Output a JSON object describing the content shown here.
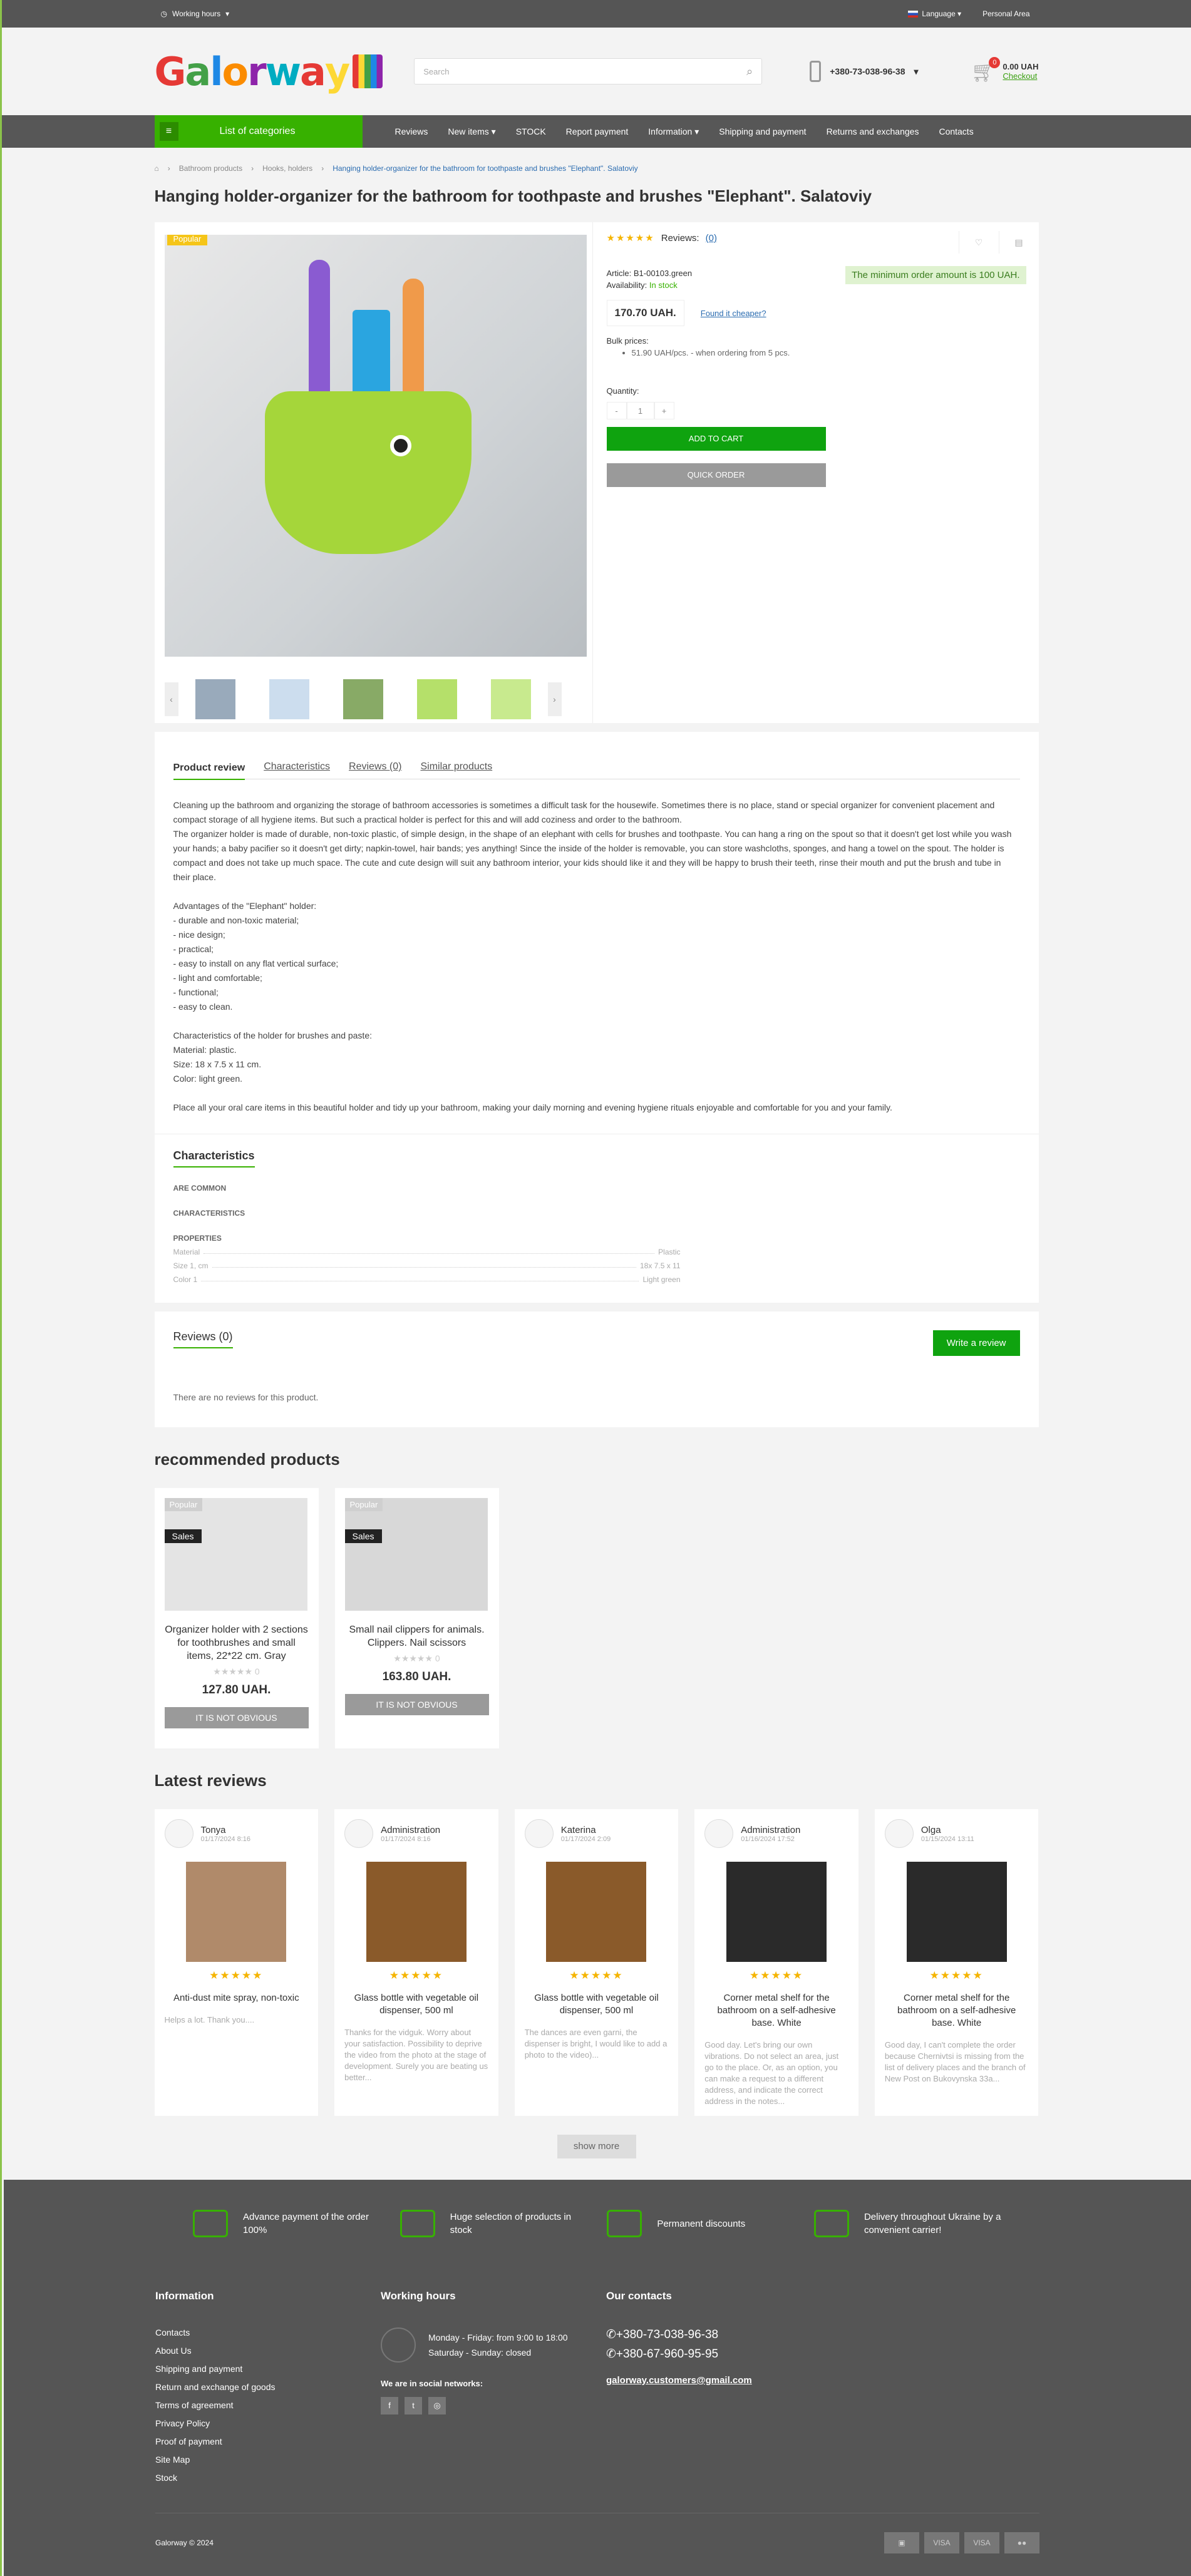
{
  "topbar": {
    "working_hours": "Working hours",
    "language": "Language",
    "personal_area": "Personal Area"
  },
  "header": {
    "logo": [
      "G",
      "a",
      "l",
      "o",
      "r",
      "w",
      "a",
      "y"
    ],
    "search_placeholder": "Search",
    "phone": "+380-73-038-96-38",
    "cart_count": "0",
    "cart_total": "0.00 UAH",
    "checkout": "Checkout"
  },
  "nav": {
    "categories": "List of categories",
    "items": [
      "Reviews",
      "New items",
      "STOCK",
      "Report payment",
      "Information",
      "Shipping and payment",
      "Returns and exchanges",
      "Contacts"
    ]
  },
  "breadcrumb": [
    "Bathroom products",
    "Hooks, holders",
    "Hanging holder-organizer for the bathroom for toothpaste and brushes \"Elephant\". Salatoviy"
  ],
  "product": {
    "title": "Hanging holder-organizer for the bathroom for toothpaste and brushes \"Elephant\". Salatoviy",
    "badge": "Popular",
    "stars": "★★★★★",
    "reviews_label": "Reviews:",
    "reviews_count": "(0)",
    "min_order": "The minimum order amount is 100 UAH.",
    "article_label": "Article:",
    "article": "B1-00103.green",
    "availability_label": "Availability:",
    "availability": "In stock",
    "price": "170.70 UAH.",
    "cheaper": "Found it cheaper?",
    "bulk_title": "Bulk prices:",
    "bulk_item": "51.90 UAH/pcs. - when ordering from 5 pcs.",
    "quantity_label": "Quantity:",
    "quantity": "1",
    "add_to_cart": "ADD TO CART",
    "quick_order": "QUICK ORDER"
  },
  "tabs": [
    "Product review",
    "Characteristics",
    "Reviews (0)",
    "Similar products"
  ],
  "description": [
    "Cleaning up the bathroom and organizing the storage of bathroom accessories is sometimes a difficult task for the housewife. Sometimes there is no place, stand or special organizer for convenient placement and compact storage of all hygiene items. But such a practical holder is perfect for this and will add coziness and order to the bathroom.",
    "The organizer holder is made of durable, non-toxic plastic, of simple design, in the shape of an elephant with cells for brushes and toothpaste. You can hang a ring on the spout so that it doesn't get lost while you wash your hands; a baby pacifier so it doesn't get dirty; napkin-towel, hair bands; yes anything! Since the inside of the holder is removable, you can store washcloths, sponges, and hang a towel on the spout. The holder is compact and does not take up much space. The cute and cute design will suit any bathroom interior, your kids should like it and they will be happy to brush their teeth, rinse their mouth and put the brush and tube in their place.",
    "",
    "Advantages of the \"Elephant\" holder:",
    "- durable and non-toxic material;",
    "- nice design;",
    "- practical;",
    "- easy to install on any flat vertical surface;",
    "- light and comfortable;",
    "- functional;",
    "- easy to clean.",
    "",
    "Characteristics of the holder for brushes and paste:",
    "Material: plastic.",
    "Size: 18 x 7.5 x 11 cm.",
    "Color: light green.",
    "",
    "Place all your oral care items in this beautiful holder and tidy up your bathroom, making your daily morning and evening hygiene rituals enjoyable and comfortable for you and your family."
  ],
  "characteristics": {
    "title": "Characteristics",
    "groups": [
      "ARE COMMON",
      "CHARACTERISTICS",
      "PROPERTIES"
    ],
    "rows": [
      {
        "k": "Material",
        "v": "Plastic"
      },
      {
        "k": "Size 1, cm",
        "v": "18x 7.5 x 11"
      },
      {
        "k": "Color 1",
        "v": "Light green"
      }
    ]
  },
  "reviews": {
    "title": "Reviews (0)",
    "write": "Write a review",
    "none": "There are no reviews for this product."
  },
  "recommended": {
    "title": "recommended products",
    "items": [
      {
        "popular": "Popular",
        "sales": "Sales",
        "title": "Organizer holder with 2 sections for toothbrushes and small items, 22*22 cm. Gray",
        "stars": "★★★★★",
        "count": "0",
        "price": "127.80 UAH.",
        "btn": "IT IS NOT OBVIOUS"
      },
      {
        "popular": "Popular",
        "sales": "Sales",
        "title": "Small nail clippers for animals. Clippers. Nail scissors",
        "stars": "★★★★★",
        "count": "0",
        "price": "163.80 UAH.",
        "btn": "IT IS NOT OBVIOUS"
      }
    ]
  },
  "latest": {
    "title": "Latest reviews",
    "more": "show more",
    "items": [
      {
        "name": "Tonya",
        "date": "01/17/2024 8:16",
        "product": "Anti-dust mite spray, non-toxic",
        "text": "Helps a lot. Thank you...."
      },
      {
        "name": "Administration",
        "date": "01/17/2024 8:16",
        "product": "Glass bottle with vegetable oil dispenser, 500 ml",
        "text": "Thanks for the vidguk. Worry about your satisfaction. Possibility to deprive the video from the photo at the stage of development. Surely you are beating us better..."
      },
      {
        "name": "Katerina",
        "date": "01/17/2024 2:09",
        "product": "Glass bottle with vegetable oil dispenser, 500 ml",
        "text": "The dances are even garni, the dispenser is bright, I would like to add a photo to the video)..."
      },
      {
        "name": "Administration",
        "date": "01/16/2024 17:52",
        "product": "Corner metal shelf for the bathroom on a self-adhesive base. White",
        "text": "Good day. Let's bring our own vibrations. Do not select an area, just go to the place. Or, as an option, you can make a request to a different address, and indicate the correct address in the notes..."
      },
      {
        "name": "Olga",
        "date": "01/15/2024 13:11",
        "product": "Corner metal shelf for the bathroom on a self-adhesive base. White",
        "text": "Good day, I can't complete the order because Chernivtsi is missing from the list of delivery places and the branch of New Post on Bukovynska 33a..."
      }
    ]
  },
  "footer": {
    "features": [
      "Advance payment of the order 100%",
      "Huge selection of products in stock",
      "Permanent discounts",
      "Delivery throughout Ukraine by a convenient carrier!"
    ],
    "info_title": "Information",
    "info_links": [
      "Contacts",
      "About Us",
      "Shipping and payment",
      "Return and exchange of goods",
      "Terms of agreement",
      "Privacy Policy",
      "Proof of payment",
      "Site Map",
      "Stock"
    ],
    "hours_title": "Working hours",
    "hours": [
      "Monday - Friday: from 9:00 to 18:00",
      "Saturday - Sunday: closed"
    ],
    "social_title": "We are in social networks:",
    "social": [
      "f",
      "t",
      "◎"
    ],
    "contacts_title": "Our contacts",
    "phones": [
      "+380-73-038-96-38",
      "+380-67-960-95-95"
    ],
    "email": "galorway.customers@gmail.com",
    "copyright": "Galorway © 2024",
    "payments": [
      "▣",
      "VISA",
      "VISA",
      "●●"
    ]
  }
}
